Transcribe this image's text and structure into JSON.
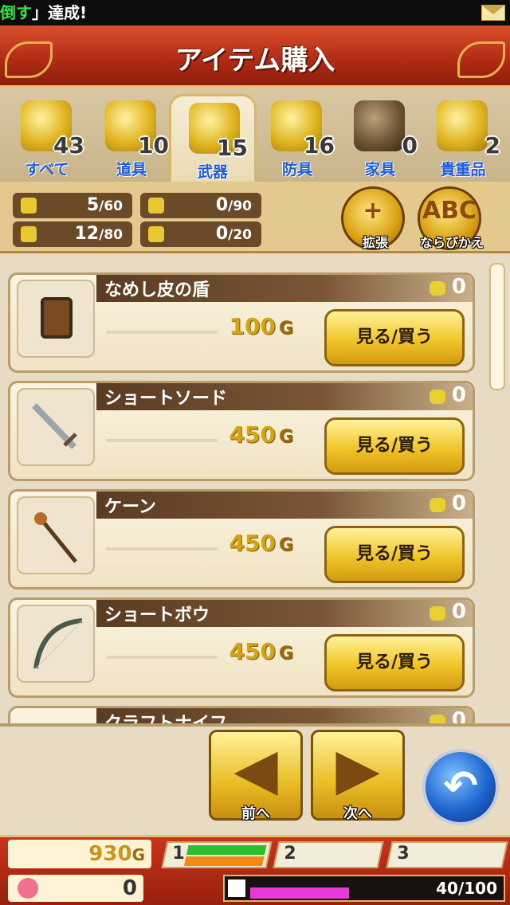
{
  "ticker": {
    "highlight": "倒す",
    "text": "」達成!"
  },
  "header": {
    "title": "アイテム購入"
  },
  "tabs": [
    {
      "label": "すべて",
      "count": "43"
    },
    {
      "label": "道具",
      "count": "10"
    },
    {
      "label": "武器",
      "count": "15"
    },
    {
      "label": "防具",
      "count": "16"
    },
    {
      "label": "家具",
      "count": "0"
    },
    {
      "label": "貴重品",
      "count": "2"
    }
  ],
  "capacity": [
    {
      "icon": "bag-icon",
      "value": "5",
      "max": "/60"
    },
    {
      "icon": "storage-icon",
      "value": "0",
      "max": "/90"
    },
    {
      "icon": "armor-icon",
      "value": "12",
      "max": "/80"
    },
    {
      "icon": "house-icon",
      "value": "0",
      "max": "/20"
    }
  ],
  "actions": {
    "expand": "拡張",
    "sort": "ならびかえ",
    "sort_glyph": "ABC"
  },
  "items": [
    {
      "name": "なめし皮の盾",
      "owned": "0",
      "price": "100",
      "unit": "G",
      "buy": "見る/買う"
    },
    {
      "name": "ショートソード",
      "owned": "0",
      "price": "450",
      "unit": "G",
      "buy": "見る/買う"
    },
    {
      "name": "ケーン",
      "owned": "0",
      "price": "450",
      "unit": "G",
      "buy": "見る/買う"
    },
    {
      "name": "ショートボウ",
      "owned": "0",
      "price": "450",
      "unit": "G",
      "buy": "見る/買う"
    },
    {
      "name": "クラフトナイフ",
      "owned": "0"
    }
  ],
  "nav": {
    "prev": "前へ",
    "next": "次へ"
  },
  "status": {
    "gold": "930",
    "gold_unit": "G",
    "party": [
      "1",
      "2",
      "3"
    ],
    "hearts": "0",
    "exp": "40/100",
    "exp_fraction": 0.4
  }
}
